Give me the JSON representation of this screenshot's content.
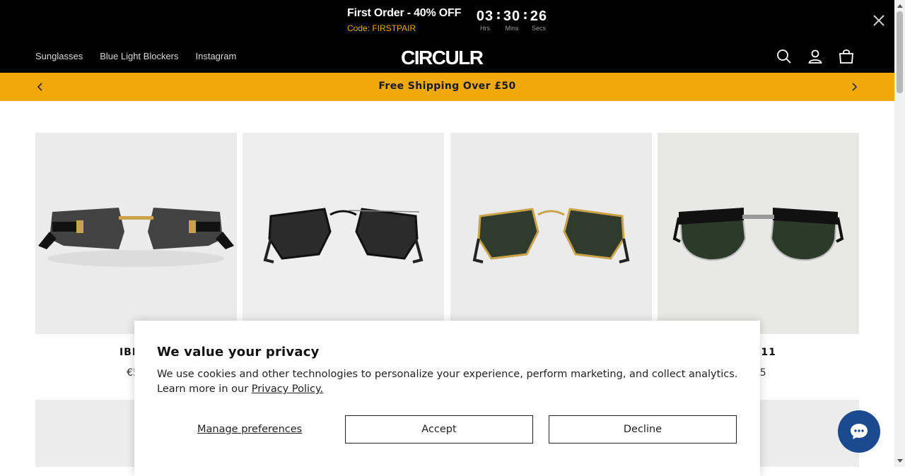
{
  "promo": {
    "title": "First Order - 40% OFF",
    "code": "Code: FIRSTPAIR",
    "timer": [
      {
        "value": "03",
        "label": "Hrs"
      },
      {
        "value": "30",
        "label": "Mins"
      },
      {
        "value": "26",
        "label": "Secs"
      }
    ],
    "separator": ":"
  },
  "header": {
    "nav": [
      "Sunglasses",
      "Blue Light Blockers",
      "Instagram"
    ],
    "logo": "CIRCULR"
  },
  "shipbar": {
    "text": "Free Shipping Over £50"
  },
  "products": [
    {
      "title": "IBIZA",
      "price": "€52"
    },
    {
      "title": "",
      "price": ""
    },
    {
      "title": "",
      "price": ""
    },
    {
      "title": "D 111",
      "price": ",95"
    }
  ],
  "cookie": {
    "title": "We value your privacy",
    "body": "We use cookies and other technologies to personalize your experience, perform marketing, and collect analytics. Learn more in our ",
    "link": "Privacy Policy.",
    "manage": "Manage preferences",
    "accept": "Accept",
    "decline": "Decline"
  },
  "colors": {
    "accent": "#f0a90a",
    "chat": "#1a4a8f"
  }
}
